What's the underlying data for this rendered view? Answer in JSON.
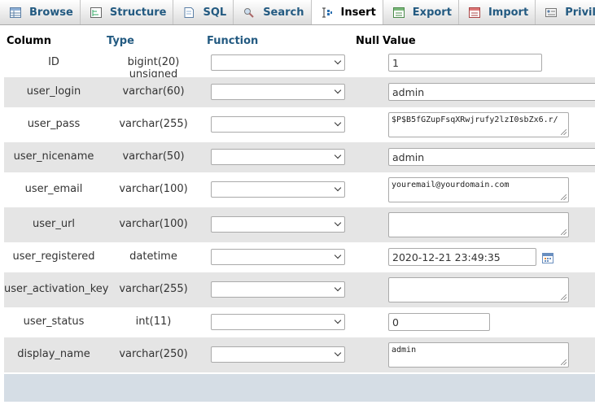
{
  "tabs": [
    {
      "label": "Browse",
      "icon": "browse-icon",
      "active": false
    },
    {
      "label": "Structure",
      "icon": "structure-icon",
      "active": false
    },
    {
      "label": "SQL",
      "icon": "sql-icon",
      "active": false
    },
    {
      "label": "Search",
      "icon": "search-icon",
      "active": false
    },
    {
      "label": "Insert",
      "icon": "insert-icon",
      "active": true
    },
    {
      "label": "Export",
      "icon": "export-icon",
      "active": false
    },
    {
      "label": "Import",
      "icon": "import-icon",
      "active": false
    },
    {
      "label": "Privileges",
      "icon": "privileges-icon",
      "active": false
    }
  ],
  "headers": {
    "column": "Column",
    "type": "Type",
    "function": "Function",
    "null": "Null",
    "value": "Value"
  },
  "rows": [
    {
      "column": "ID",
      "type": "bigint(20) unsigned",
      "value": "1"
    },
    {
      "column": "user_login",
      "type": "varchar(60)",
      "value": "admin"
    },
    {
      "column": "user_pass",
      "type": "varchar(255)",
      "value": "$P$B5fGZupFsqXRwjrufy2lzI0sbZx6.r/"
    },
    {
      "column": "user_nicename",
      "type": "varchar(50)",
      "value": "admin"
    },
    {
      "column": "user_email",
      "type": "varchar(100)",
      "value": "youremail@yourdomain.com"
    },
    {
      "column": "user_url",
      "type": "varchar(100)",
      "value": ""
    },
    {
      "column": "user_registered",
      "type": "datetime",
      "value": "2020-12-21 23:49:35"
    },
    {
      "column": "user_activation_key",
      "type": "varchar(255)",
      "value": ""
    },
    {
      "column": "user_status",
      "type": "int(11)",
      "value": "0"
    },
    {
      "column": "display_name",
      "type": "varchar(250)",
      "value": "admin"
    }
  ],
  "colors": {
    "header_link": "#235a81",
    "even_row": "#e5e5e5",
    "footer": "#d5dde5"
  }
}
